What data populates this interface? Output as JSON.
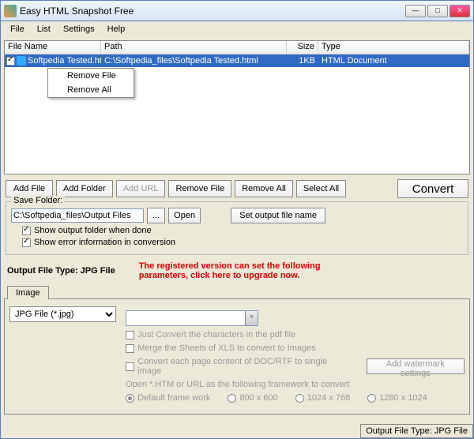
{
  "window": {
    "title": "Easy HTML Snapshot Free"
  },
  "menu": {
    "file": "File",
    "list": "List",
    "settings": "Settings",
    "help": "Help"
  },
  "cols": {
    "name": "File Name",
    "path": "Path",
    "size": "Size",
    "type": "Type"
  },
  "row": {
    "name": "Softpedia Tested.html",
    "path": "C:\\Softpedia_files\\Softpedia Tested.html",
    "size": "1KB",
    "type": "HTML Document"
  },
  "ctx": {
    "remove_file": "Remove File",
    "remove_all": "Remove All"
  },
  "btns": {
    "add_file": "Add File",
    "add_folder": "Add Folder",
    "add_url": "Add URL",
    "remove_file": "Remove File",
    "remove_all": "Remove All",
    "select_all": "Select All",
    "convert": "Convert"
  },
  "save": {
    "group": "Save Folder:",
    "path": "C:\\Softpedia_files\\Output Files",
    "browse": "...",
    "open": "Open",
    "set_name": "Set output file name",
    "show_folder": "Show output folder when done",
    "show_error": "Show error information in conversion"
  },
  "oft": {
    "label": "Output File Type:  JPG File"
  },
  "upgrade": "The registered version can set the following parameters, click here to upgrade now.",
  "tab": {
    "image": "Image"
  },
  "img": {
    "filter": "JPG File  (*.jpg)",
    "opt1": "Just Convert the characters in the pdf file",
    "opt2": "Merge the Sheets of XLS to convert to Images",
    "opt3": "Convert each page content of DOC/RTF to single image",
    "watermark": "Add watermark settings",
    "note": "Open *.HTM or URL as the following framework to convert",
    "r1": "Default frame work",
    "r2": "800 x 600",
    "r3": "1024 x 768",
    "r4": "1280 x 1024"
  },
  "status": "Output File Type:  JPG File"
}
